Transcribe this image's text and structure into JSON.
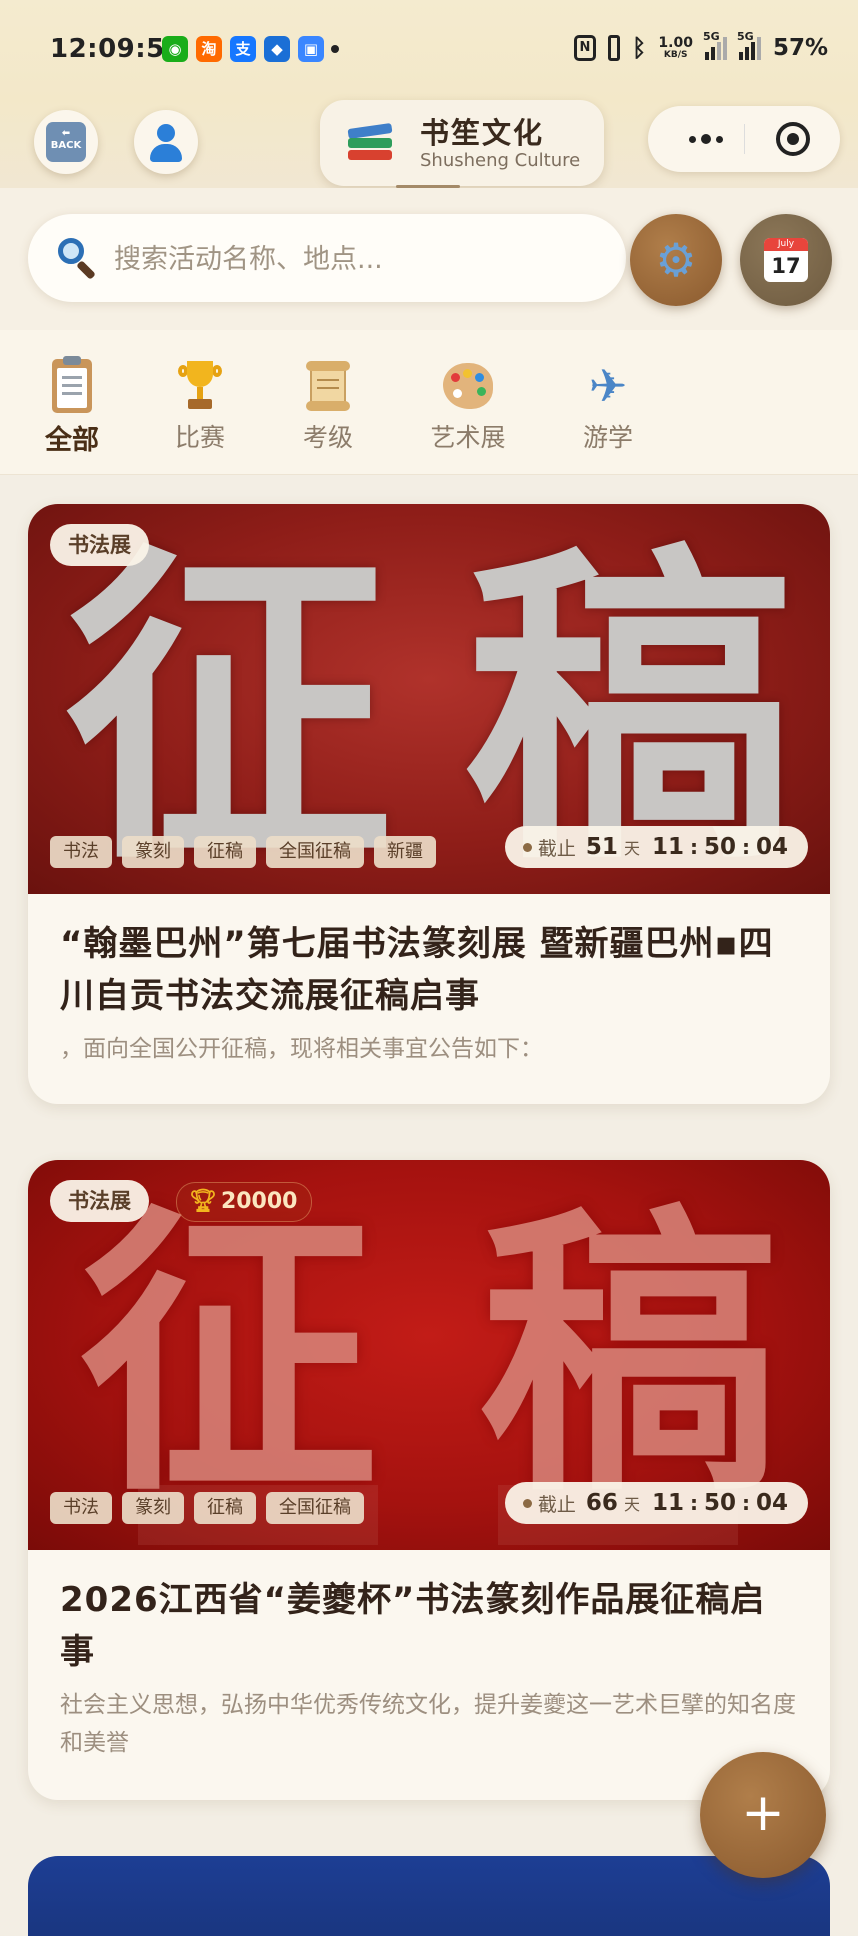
{
  "status_bar": {
    "time": "12:09:54",
    "apps": [
      {
        "name": "wechat-icon",
        "glyph": "◉",
        "color": "#1aad19"
      },
      {
        "name": "taobao-icon",
        "glyph": "淘",
        "color": "#ff6a00"
      },
      {
        "name": "alipay-icon",
        "glyph": "支",
        "color": "#1677ff"
      },
      {
        "name": "app-robot-icon",
        "glyph": "◆",
        "color": "#1b6fd6"
      },
      {
        "name": "app-blue-icon",
        "glyph": "▣",
        "color": "#3a86ff"
      }
    ],
    "net_speed_value": "1.00",
    "net_speed_unit": "KB/S",
    "network_1": "5G",
    "network_2": "5G",
    "battery": "57%"
  },
  "header": {
    "back_label": "BACK",
    "brand_title": "书笙文化",
    "brand_subtitle": "Shusheng Culture"
  },
  "search": {
    "placeholder": "搜索活动名称、地点...",
    "calendar_month": "July",
    "calendar_day": "17"
  },
  "categories": [
    {
      "label": "全部",
      "icon": "clipboard-icon",
      "active": true
    },
    {
      "label": "比赛",
      "icon": "trophy-icon",
      "active": false
    },
    {
      "label": "考级",
      "icon": "scroll-icon",
      "active": false
    },
    {
      "label": "艺术展",
      "icon": "palette-icon",
      "active": false
    },
    {
      "label": "游学",
      "icon": "airplane-icon",
      "active": false
    }
  ],
  "events": [
    {
      "category": "书法展",
      "banner_text": [
        "征",
        "稿"
      ],
      "tags": [
        "书法",
        "篆刻",
        "征稿",
        "全国征稿",
        "新疆"
      ],
      "deadline_label": "截止",
      "days": "51",
      "days_unit": "天",
      "hours": "11",
      "minutes": "50",
      "seconds": "04",
      "title": "“翰墨巴州”第七届书法篆刻展 暨新疆巴州▪四川自贡书法交流展征稿启事",
      "description": "，面向全国公开征稿，现将相关事宜公告如下："
    },
    {
      "category": "书法展",
      "prize": "20000",
      "banner_text": [
        "征",
        "稿"
      ],
      "tags": [
        "书法",
        "篆刻",
        "征稿",
        "全国征稿"
      ],
      "deadline_label": "截止",
      "days": "66",
      "days_unit": "天",
      "hours": "11",
      "minutes": "50",
      "seconds": "04",
      "title": "2026江西省“姜夔杯”书法篆刻作品展征稿启事",
      "description": "社会主义思想，弘扬中华优秀传统文化，提升姜夔这一艺术巨擘的知名度和美誉"
    }
  ],
  "fab": {
    "label": "+"
  },
  "colors": {
    "accent_brown": "#8a5a2e",
    "background": "#f3eee4",
    "active_category": "#4a2f17"
  }
}
